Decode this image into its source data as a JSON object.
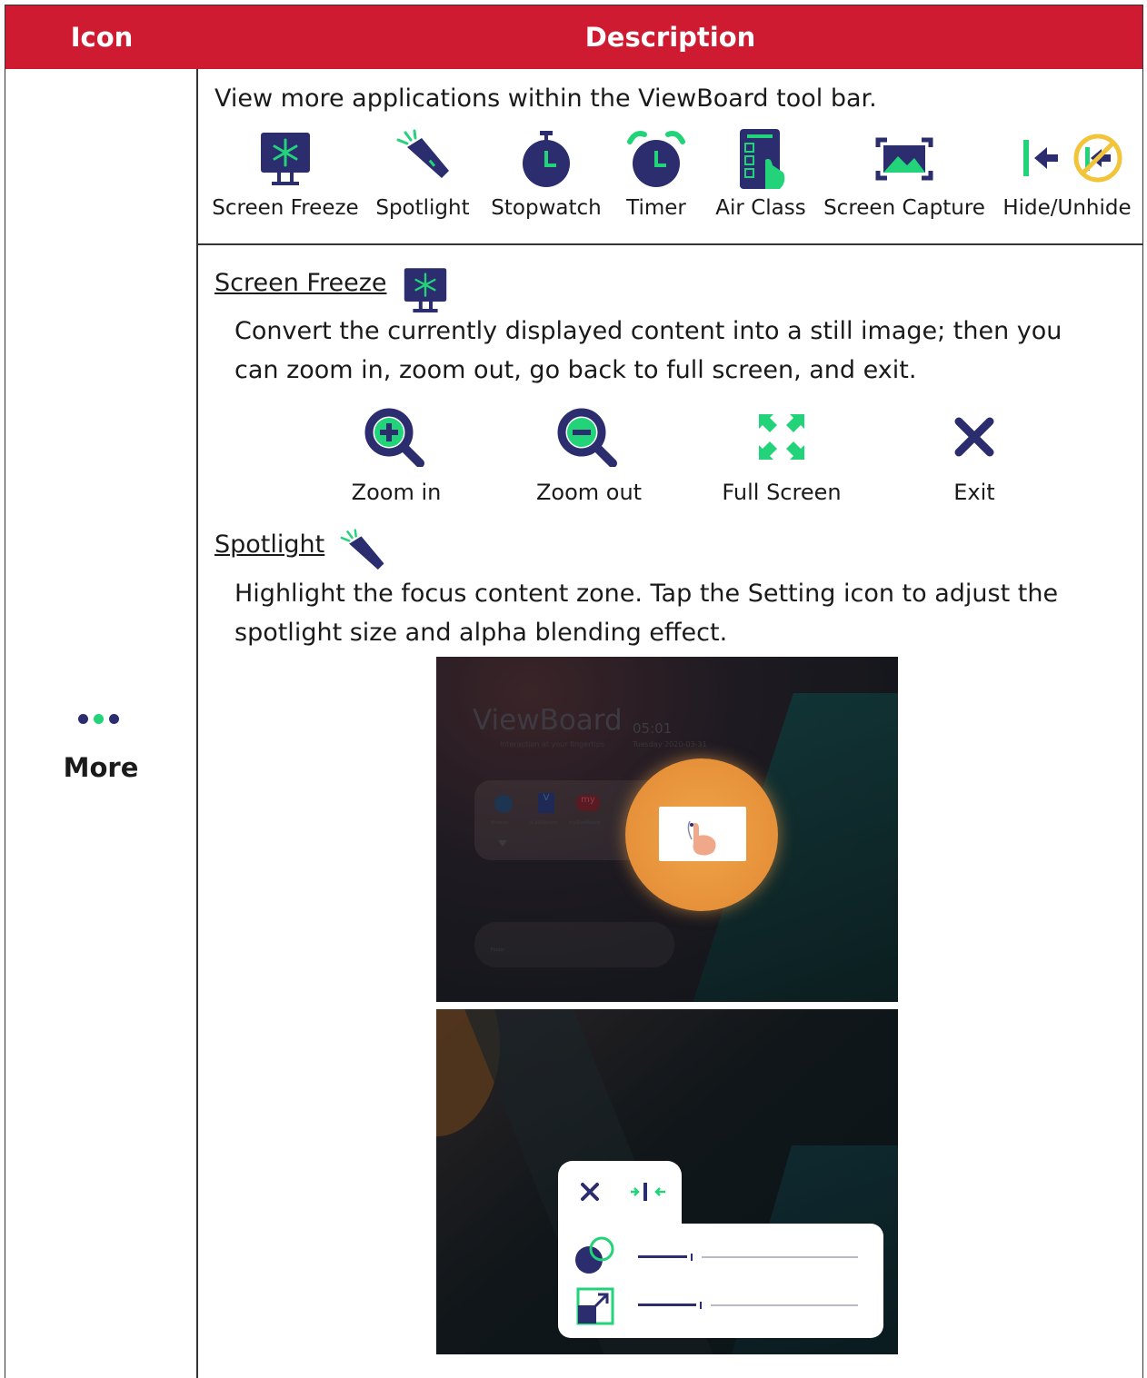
{
  "header": {
    "icon": "Icon",
    "description": "Description"
  },
  "row": {
    "icon_name": "more-dots-icon",
    "label": "More"
  },
  "intro": "View more applications within the ViewBoard tool bar.",
  "tools": [
    {
      "label": "Screen Freeze",
      "icon": "screen-freeze-icon"
    },
    {
      "label": "Spotlight",
      "icon": "spotlight-icon"
    },
    {
      "label": "Stopwatch",
      "icon": "stopwatch-icon"
    },
    {
      "label": "Timer",
      "icon": "timer-icon"
    },
    {
      "label": "Air Class",
      "icon": "air-class-icon"
    },
    {
      "label": "Screen",
      "label2": "Capture",
      "icon": "screen-capture-icon"
    },
    {
      "label": "Hide/Unhide",
      "icon": "hide-unhide-icon"
    }
  ],
  "screen_freeze": {
    "title": "Screen Freeze",
    "line1": "Convert the currently displayed content into a still image; then you",
    "line2": "can zoom in, zoom out, go back to full screen, and exit.",
    "controls": [
      {
        "label": "Zoom in",
        "icon": "zoom-in-icon"
      },
      {
        "label": "Zoom out",
        "icon": "zoom-out-icon"
      },
      {
        "label": "Full Screen",
        "icon": "full-screen-icon"
      },
      {
        "label": "Exit",
        "icon": "exit-icon"
      }
    ]
  },
  "spotlight": {
    "title": "Spotlight",
    "line1": "Highlight the focus content zone. Tap the Setting icon to adjust the",
    "line2": "spotlight size and alpha blending effect."
  },
  "screenshot": {
    "brand": "ViewBoard",
    "time": "05:01",
    "tagline": "Interaction at your fingertips",
    "date": "Tuesday 2020-03-31",
    "apps": [
      "Browser",
      "vCastSender",
      "myViewBoard"
    ],
    "app_badges": {
      "vcast": "V",
      "my": "my"
    },
    "folder": "Folder"
  },
  "colors": {
    "header_red": "#cf1b32",
    "navy": "#2b2d6e",
    "green": "#22d37a"
  }
}
